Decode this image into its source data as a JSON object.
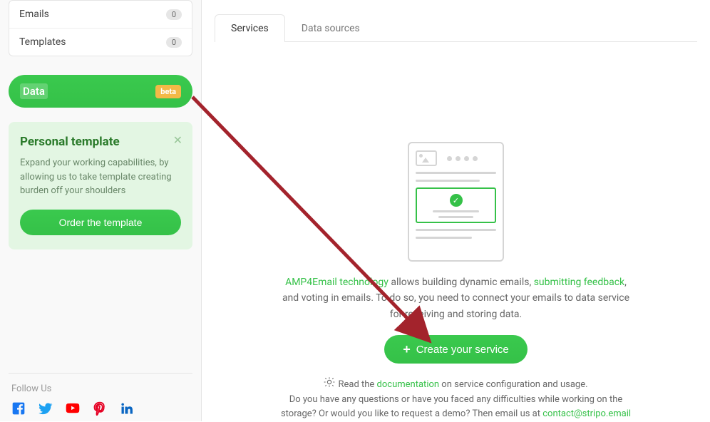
{
  "sidebar": {
    "nav": [
      {
        "label": "Emails",
        "count": "0"
      },
      {
        "label": "Templates",
        "count": "0"
      }
    ],
    "data_item": {
      "label": "Data",
      "badge": "beta"
    },
    "promo": {
      "title": "Personal template",
      "body": "Expand your working capabilities, by allowing us to take template creating burden off your shoulders",
      "cta": "Order the template"
    },
    "follow_label": "Follow Us"
  },
  "tabs": [
    {
      "label": "Services",
      "active": true
    },
    {
      "label": "Data sources",
      "active": false
    }
  ],
  "desc": {
    "link1": "AMP4Email technology",
    "part1": " allows building dynamic emails, ",
    "link2": "submitting feedback",
    "part2": ", and voting in emails. To do so, you need to connect your emails to data service for receiving and storing data."
  },
  "create_label": "Create your service",
  "footnote": {
    "line1a": "Read the ",
    "line1_link": "documentation",
    "line1b": " on service configuration and usage.",
    "line2a": "Do you have any questions or have you faced any difficulties while working on the storage? Or would you like to request a demo? Then email us at ",
    "line2_link": "contact@stripo.email"
  }
}
